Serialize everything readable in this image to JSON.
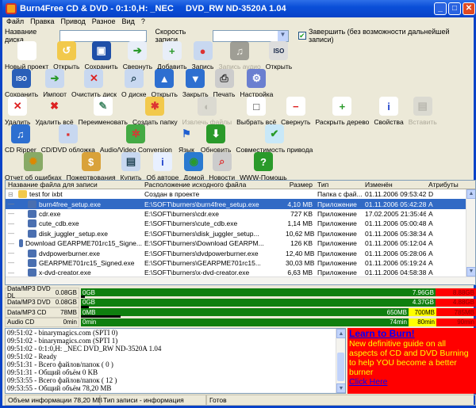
{
  "window": {
    "title": "Burn4Free CD & DVD - 0:1:0,H: _NEC     DVD_RW ND-3520A 1.04"
  },
  "menu": [
    "Файл",
    "Правка",
    "Привод",
    "Разное",
    "Вид",
    "?"
  ],
  "options": {
    "disc_name_label": "Название диска",
    "disc_name_value": "",
    "speed_label": "Скорость записи",
    "speed_value": "",
    "finalize_label": "Завершить (без возможности дальнейшей записи)",
    "finalize_checked": true
  },
  "toolbar": [
    [
      {
        "label": "Новый проект",
        "icon": "new-file-icon"
      },
      {
        "label": "Открыть",
        "icon": "open-folder-icon"
      },
      {
        "label": "Сохранить",
        "icon": "floppy-icon"
      },
      {
        "label": "Свернуть",
        "icon": "compress-icon"
      },
      {
        "label": "Добавить",
        "icon": "add-file-icon"
      },
      {
        "label": "Запись",
        "icon": "burn-disc-icon"
      },
      {
        "label": "Запись аудио",
        "icon": "audio-burn-icon",
        "disabled": true
      },
      {
        "label": "Открыть",
        "icon": "iso-icon"
      }
    ],
    [
      {
        "label": "Сохранить",
        "icon": "save-iso-icon"
      },
      {
        "label": "Импорт",
        "icon": "import-disc-icon"
      },
      {
        "label": "Очистить диск",
        "icon": "erase-disc-icon"
      },
      {
        "label": "О диске",
        "icon": "disc-info-icon"
      },
      {
        "label": "Открыть",
        "icon": "eject-icon"
      },
      {
        "label": "Закрыть",
        "icon": "close-tray-icon"
      },
      {
        "label": "Печать",
        "icon": "printer-icon"
      },
      {
        "label": "Настройка",
        "icon": "settings-icon"
      }
    ],
    [
      {
        "label": "Удалить",
        "icon": "delete-icon"
      },
      {
        "label": "Удалить всё",
        "icon": "delete-all-icon"
      },
      {
        "label": "Переименовать",
        "icon": "rename-icon"
      },
      {
        "label": "Создать папку",
        "icon": "new-folder-icon"
      },
      {
        "label": "Извлечь файлы",
        "icon": "extract-icon",
        "disabled": true
      },
      {
        "label": "Выбрать всё",
        "icon": "select-all-icon"
      },
      {
        "label": "Свернуть",
        "icon": "collapse-icon"
      },
      {
        "label": "Раскрыть дерево",
        "icon": "expand-icon"
      },
      {
        "label": "Свойства",
        "icon": "properties-icon"
      },
      {
        "label": "Вставить",
        "icon": "paste-icon",
        "disabled": true
      }
    ],
    [
      {
        "label": "CD Ripper",
        "icon": "cd-ripper-icon"
      },
      {
        "label": "CD/DVD обложка",
        "icon": "cover-icon"
      },
      {
        "label": "Audio/Video Conversion",
        "icon": "conversion-icon"
      },
      {
        "label": "Язык",
        "icon": "flag-icon"
      },
      {
        "label": "Обновить",
        "icon": "update-globe-icon"
      },
      {
        "label": "Совместимость привода",
        "icon": "checkmark-icon"
      }
    ],
    [
      {
        "label": "Отчет об ошибках",
        "icon": "bug-report-icon"
      },
      {
        "label": "Пожертвования",
        "icon": "money-bag-icon"
      },
      {
        "label": "Купить",
        "icon": "buy-icon"
      },
      {
        "label": "Об авторе",
        "icon": "info-icon"
      },
      {
        "label": "Домой",
        "icon": "home-globe-icon"
      },
      {
        "label": "Новости",
        "icon": "news-icon"
      },
      {
        "label": "WWW-Помощь",
        "icon": "web-help-icon"
      }
    ]
  ],
  "filelist": {
    "columns": [
      "Название файла для записи",
      "Расположение исходного файла",
      "Размер",
      "Тип",
      "Изменён",
      "Атрибуты"
    ],
    "rows": [
      [
        "test for ixbt",
        "Создан в проекте",
        "",
        "Папка с фай...",
        "01.11.2006 09:53:42",
        "D"
      ],
      [
        "burn4free_setup.exe",
        "E:\\SOFT\\burners\\burn4free_setup.exe",
        "4,10 MB",
        "Приложение",
        "01.11.2006 05:42:28",
        "A"
      ],
      [
        "cdr.exe",
        "E:\\SOFT\\burners\\cdr.exe",
        "727 KB",
        "Приложение",
        "17.02.2005 21:35:46",
        "A"
      ],
      [
        "cute_cdb.exe",
        "E:\\SOFT\\burners\\cute_cdb.exe",
        "1,14 MB",
        "Приложение",
        "01.11.2006 05:00:48",
        "A"
      ],
      [
        "disk_juggler_setup.exe",
        "E:\\SOFT\\burners\\disk_juggler_setup...",
        "10,62 MB",
        "Приложение",
        "01.11.2006 05:38:34",
        "A"
      ],
      [
        "Download GEARPME701rc15_Signe...",
        "E:\\SOFT\\burners\\Download GEARPM...",
        "126 KB",
        "Приложение",
        "01.11.2006 05:12:04",
        "A"
      ],
      [
        "dvdpowerburner.exe",
        "E:\\SOFT\\burners\\dvdpowerburner.exe",
        "12,40 MB",
        "Приложение",
        "01.11.2006 05:28:06",
        "A"
      ],
      [
        "GEARPME701rc15_Signed.exe",
        "E:\\SOFT\\burners\\GEARPME701rc15...",
        "30,03 MB",
        "Приложение",
        "01.11.2006 05:19:24",
        "A"
      ],
      [
        "x-dvd-creator.exe",
        "E:\\SOFT\\burners\\x-dvd-creator.exe",
        "6,63 MB",
        "Приложение",
        "01.11.2006 04:58:38",
        "A"
      ]
    ],
    "selected_index": 1
  },
  "capacity": [
    {
      "label": "Data/MP3 DVD DL",
      "used": "0.08GB",
      "start": "0GB",
      "segments": [
        {
          "text": "7.96GB",
          "color": "g"
        },
        {
          "text": "8.88GB",
          "color": "r"
        }
      ],
      "fill_fraction": 0.01
    },
    {
      "label": "Data/MP3 DVD",
      "used": "0.08GB",
      "start": "0GB",
      "segments": [
        {
          "text": "4.37GB",
          "color": "g"
        },
        {
          "text": "4.88GB",
          "color": "r"
        }
      ],
      "fill_fraction": 0.02
    },
    {
      "label": "Data/MP3 CD",
      "used": "78MB",
      "start": "0MB",
      "segments": [
        {
          "text": "650MB",
          "color": "g"
        },
        {
          "text": "700MB",
          "color": "y"
        },
        {
          "text": "785MB",
          "color": "r"
        }
      ],
      "fill_fraction": 0.1
    },
    {
      "label": "Audio CD",
      "used": "0min",
      "start": "0min",
      "segments": [
        {
          "text": "74min",
          "color": "g"
        },
        {
          "text": "80min",
          "color": "y"
        },
        {
          "text": "90min",
          "color": "r"
        }
      ],
      "fill_fraction": 0
    }
  ],
  "log": [
    "09:51:02 - binarymagics.com (SPTI 0)",
    "09:51:02 - binarymagics.com (SPTI 1)",
    "09:51:02 - 0:1:0,H: _NEC DVD_RW ND-3520A 1.04",
    "09:51:02 - Ready",
    "09:51:31 - Всего файлов/папок ( 0 )",
    "09:51:31 - Общий объём 0 KB",
    "09:53:55 - Всего файлов/папок ( 12 )",
    "09:53:55 - Общий объём 78,20 MB"
  ],
  "ad": {
    "title": "Learn to Burn!",
    "body": "New definitive guide on all aspects of CD and DVD Burning to help YOU become a better burner",
    "link": "Click Here"
  },
  "status": {
    "size": "Объем информации 78,20 MB",
    "mode": "Тип записи - информация",
    "state": "Готов"
  }
}
